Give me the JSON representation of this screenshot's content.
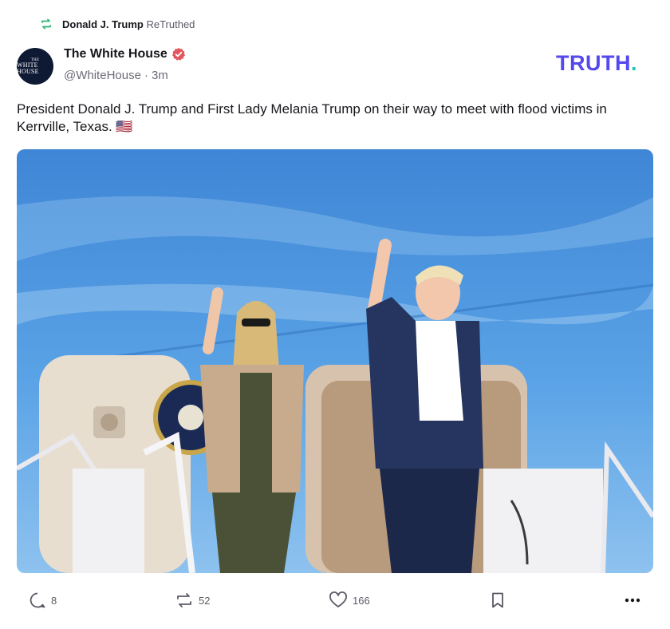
{
  "retruth": {
    "user": "Donald J. Trump",
    "label": "ReTruthed",
    "icon": "retruth-icon"
  },
  "author": {
    "display_name": "The White House",
    "handle": "@WhiteHouse",
    "separator": "·",
    "time": "3m",
    "verified_icon": "verified-badge-icon",
    "avatar_text_top": "THE",
    "avatar_text_main": "WHITE HOUSE"
  },
  "brand": {
    "logo_text": "TRUTH",
    "logo_dot": ".",
    "accent": "#5448ee",
    "dot_color": "#1fc7b5"
  },
  "post": {
    "text": "President Donald J. Trump and First Lady Melania Trump on their way to meet with flood victims in Kerrville, Texas. 🇺🇸"
  },
  "actions": {
    "replies": "8",
    "retruths": "52",
    "likes": "166",
    "reply_icon": "reply-icon",
    "retruth_icon": "retruth-icon",
    "like_icon": "heart-icon",
    "bookmark_icon": "bookmark-icon",
    "more_icon": "more-icon"
  }
}
